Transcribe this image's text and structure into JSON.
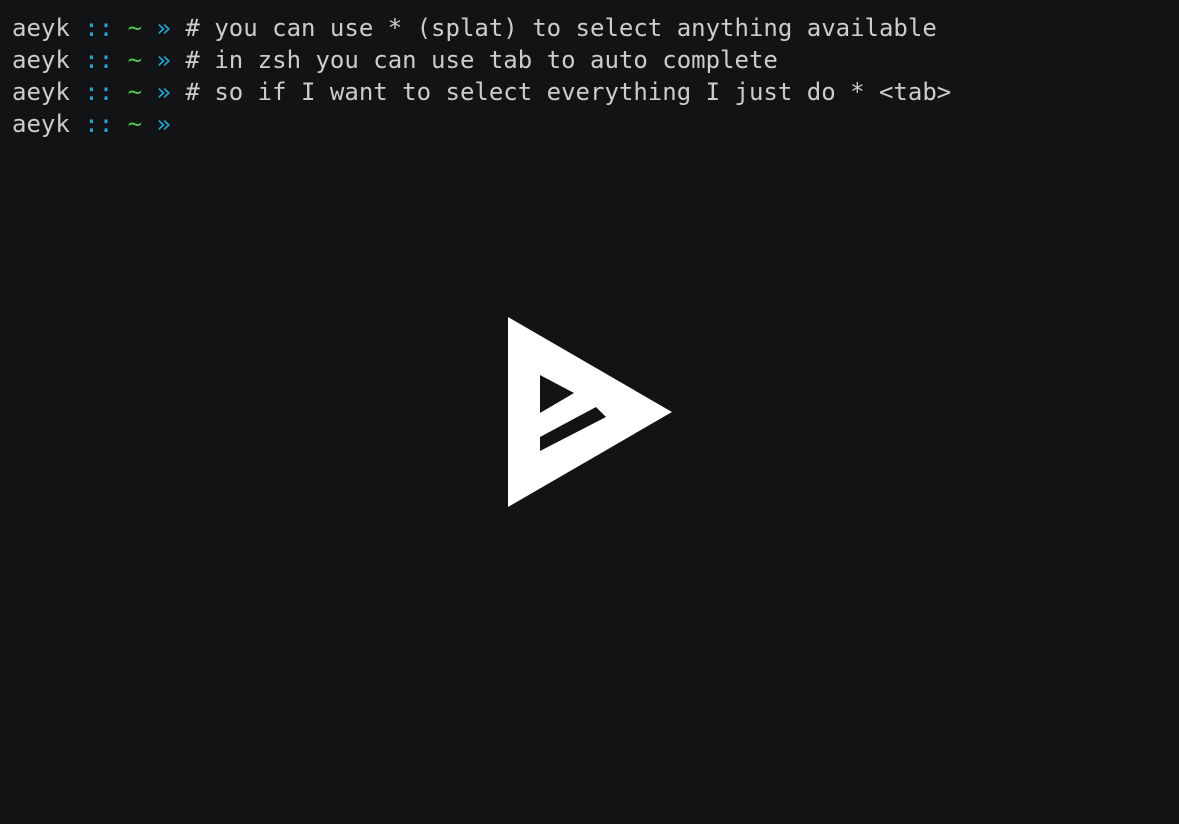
{
  "prompt": {
    "user": "aeyk",
    "separator": "::",
    "cwd": "~",
    "arrow": "»"
  },
  "lines": [
    {
      "command": "# you can use * (splat) to select anything available"
    },
    {
      "command": "# in zsh you can use tab to auto complete"
    },
    {
      "command": "# so if I want to select everything I just do * <tab>"
    },
    {
      "command": ""
    }
  ],
  "overlay": {
    "icon": "asciinema-play-icon"
  },
  "colors": {
    "background": "#121314",
    "text": "#cccccc",
    "separator": "#26a5d6",
    "cwd": "#4ec44e",
    "arrow": "#26a5d6",
    "play_icon": "#ffffff"
  }
}
